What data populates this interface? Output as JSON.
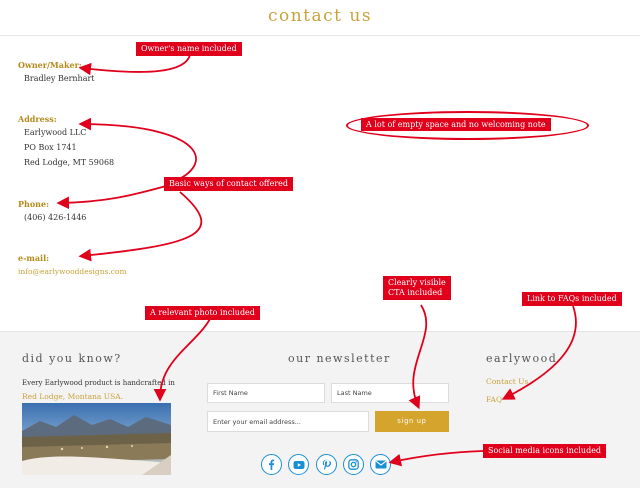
{
  "page": {
    "title": "contact us"
  },
  "contact": {
    "owner": {
      "label": "Owner/Maker:",
      "name": "Bradley Bernhart"
    },
    "address": {
      "label": "Address:",
      "lines": [
        "Earlywood LLC",
        "PO Box 1741",
        "Red Lodge, MT 59068"
      ]
    },
    "phone": {
      "label": "Phone:",
      "value": "(406) 426-1446"
    },
    "email": {
      "label": "e-mail:",
      "value": "info@earlywooddesigns.com"
    }
  },
  "footer": {
    "did_you_know": {
      "heading": "did you know?",
      "text": "Every Earlywood product is handcrafted in",
      "link": "Red Lodge, Montana USA."
    },
    "newsletter": {
      "heading": "our newsletter",
      "first_name_placeholder": "First Name",
      "last_name_placeholder": "Last Name",
      "email_placeholder": "Enter your email address...",
      "signup_label": "sign up"
    },
    "earlywood": {
      "heading": "earlywood",
      "links": [
        "Contact Us",
        "FAQ"
      ]
    },
    "social_icons": [
      "facebook-icon",
      "youtube-icon",
      "pinterest-icon",
      "instagram-icon",
      "email-icon"
    ]
  },
  "annotations": {
    "owner": "Owner's name included",
    "empty_space": "A lot of empty space and no welcoming note",
    "contact_ways": "Basic ways of contact offered",
    "photo": "A relevant photo included",
    "cta_line1": "Clearly visible",
    "cta_line2": "CTA included",
    "faq": "Link to FAQs included",
    "social": "Social media icons included"
  },
  "colors": {
    "accent": "#c9a23c",
    "button": "#d4a42c",
    "annotation": "#e0001b",
    "social": "#1a8fd8"
  }
}
